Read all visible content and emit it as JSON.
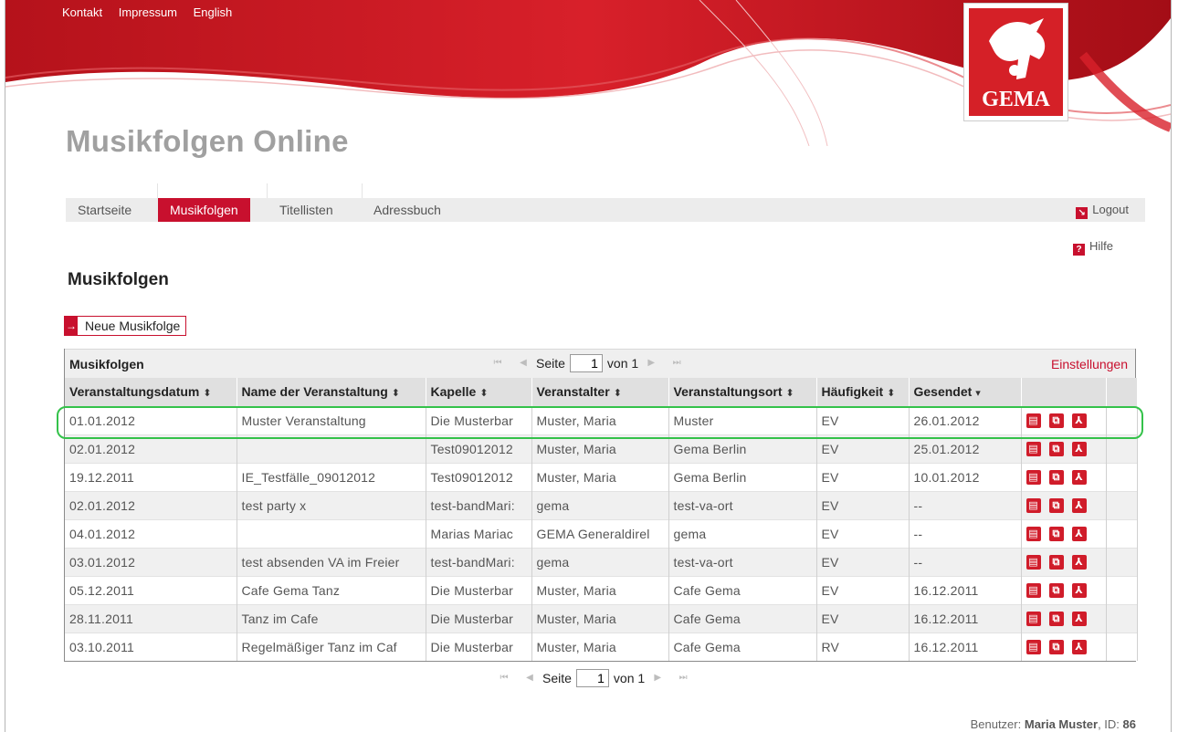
{
  "top_links": [
    "Kontakt",
    "Impressum",
    "English"
  ],
  "logo_text": "GEMA",
  "app_title": "Musikfolgen Online",
  "nav": {
    "items": [
      "Startseite",
      "Musikfolgen",
      "Titellisten",
      "Adressbuch"
    ],
    "active": "Musikfolgen",
    "logout": "Logout",
    "help": "Hilfe"
  },
  "section_title": "Musikfolgen",
  "new_button": "Neue Musikfolge",
  "grid": {
    "caption": "Musikfolgen",
    "settings": "Einstellungen",
    "pager": {
      "label": "Seite",
      "page": "1",
      "of": "von 1"
    },
    "columns": [
      {
        "label": "Veranstaltungsdatum",
        "sort": "⬍"
      },
      {
        "label": "Name der Veranstaltung",
        "sort": "⬍"
      },
      {
        "label": "Kapelle",
        "sort": "⬍"
      },
      {
        "label": "Veranstalter",
        "sort": "⬍"
      },
      {
        "label": "Veranstaltungsort",
        "sort": "⬍"
      },
      {
        "label": "Häufigkeit",
        "sort": "⬍"
      },
      {
        "label": "Gesendet",
        "sort": "▾"
      }
    ],
    "rows": [
      [
        "01.01.2012",
        "Muster Veranstaltung",
        "Die Musterbar",
        "Muster, Maria",
        "Muster",
        "EV",
        "26.01.2012"
      ],
      [
        "02.01.2012",
        "",
        "Test09012012",
        "Muster, Maria",
        "Gema Berlin",
        "EV",
        "25.01.2012"
      ],
      [
        "19.12.2011",
        "IE_Testfälle_09012012",
        "Test09012012",
        "Muster, Maria",
        "Gema Berlin",
        "EV",
        "10.01.2012"
      ],
      [
        "02.01.2012",
        "test party x",
        "test-bandMari:",
        "gema",
        "test-va-ort",
        "EV",
        "--"
      ],
      [
        "04.01.2012",
        "",
        "Marias Mariac",
        "GEMA Generaldirel",
        "gema",
        "EV",
        "--"
      ],
      [
        "03.01.2012",
        "test absenden VA im Freier",
        "test-bandMari:",
        "gema",
        "test-va-ort",
        "EV",
        "--"
      ],
      [
        "05.12.2011",
        "Cafe Gema Tanz",
        "Die Musterbar",
        "Muster, Maria",
        "Cafe Gema",
        "EV",
        "16.12.2011"
      ],
      [
        "28.11.2011",
        "Tanz im Cafe",
        "Die Musterbar",
        "Muster, Maria",
        "Cafe Gema",
        "EV",
        "16.12.2011"
      ],
      [
        "03.10.2011",
        "Regelmäßiger Tanz im Caf",
        "Die Musterbar",
        "Muster, Maria",
        "Cafe Gema",
        "RV",
        "16.12.2011"
      ]
    ],
    "row_icons": [
      "comment-icon",
      "copy-icon",
      "pdf-icon"
    ]
  },
  "footer": {
    "label": "Benutzer:",
    "user": "Maria Muster",
    "id_label": ", ID:",
    "id": "86"
  },
  "colors": {
    "brand_red": "#c8102e",
    "highlight": "#34c24a"
  }
}
